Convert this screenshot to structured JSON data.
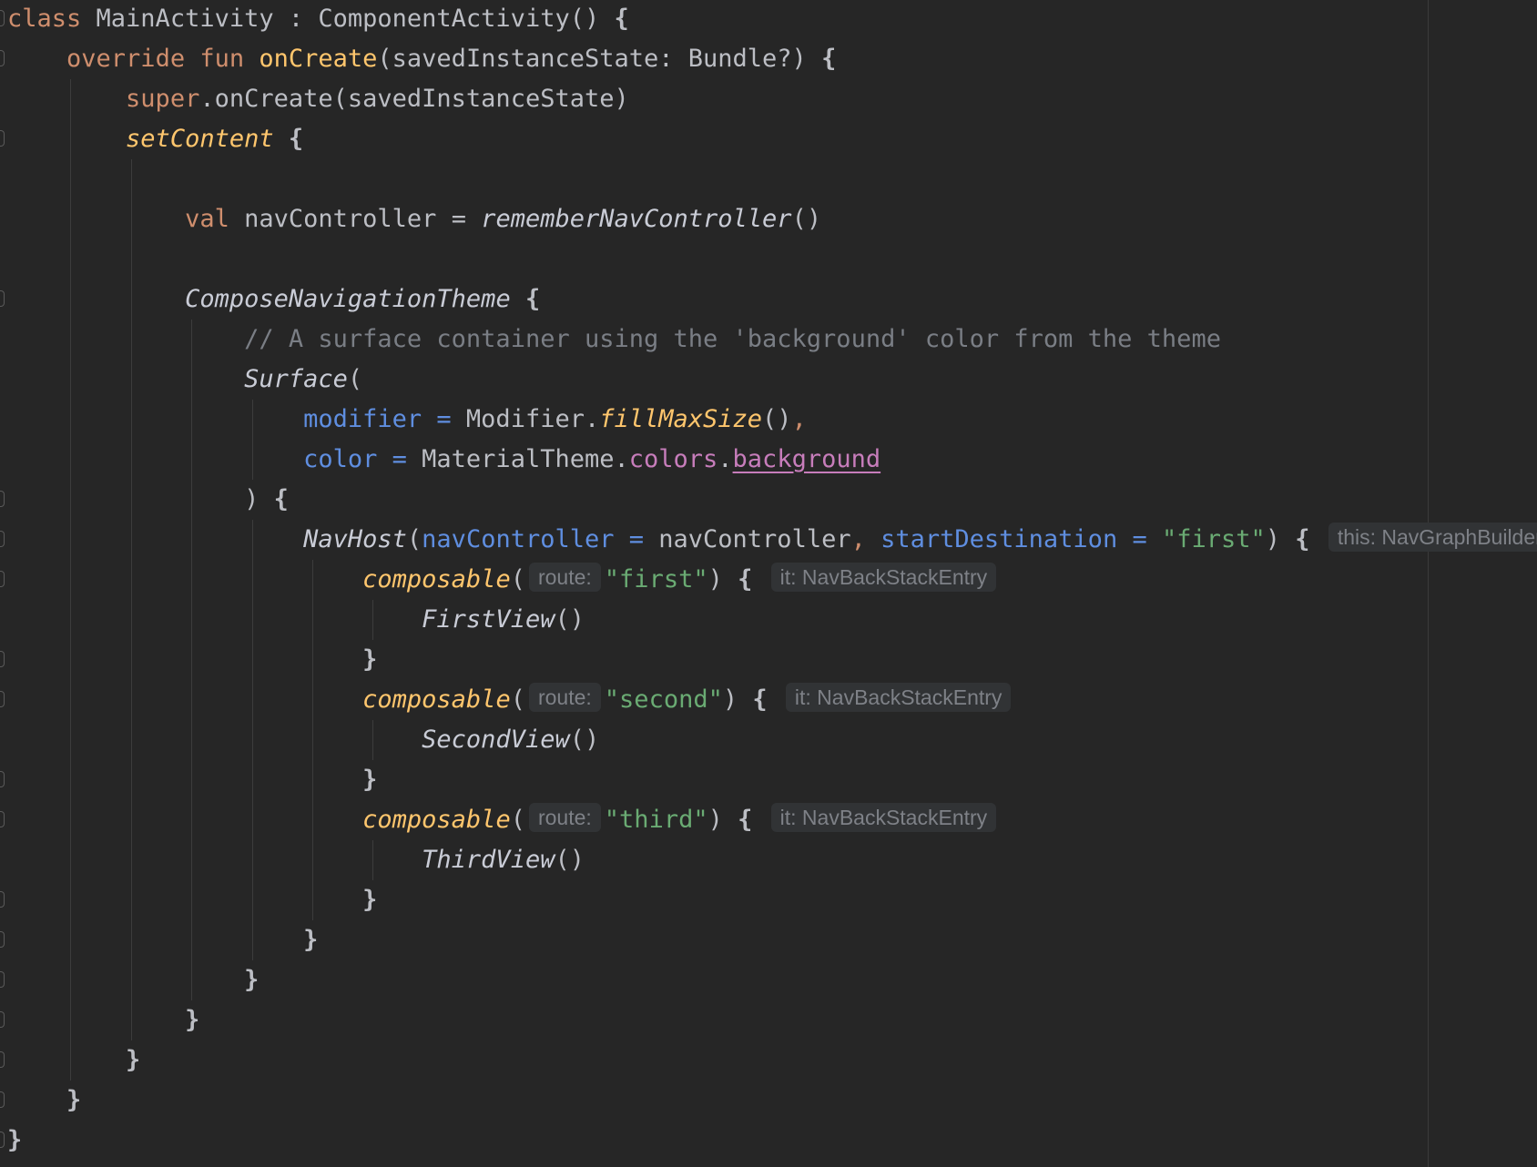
{
  "editor": {
    "theme_colors": {
      "background": "#262626",
      "keyword": "#cf8e6d",
      "function": "#ffc66d",
      "parameter": "#5f8ee0",
      "property": "#c77dbb",
      "string": "#6aab73",
      "comment": "#7a7e85",
      "text": "#bcbec4"
    },
    "lines": [
      [
        {
          "t": "kw",
          "v": "class"
        },
        {
          "t": "plain",
          "v": " MainActivity : ComponentActivity() "
        },
        {
          "t": "brace",
          "v": "{"
        }
      ],
      [
        {
          "t": "plain",
          "v": "    "
        },
        {
          "t": "kw",
          "v": "override fun "
        },
        {
          "t": "fn",
          "v": "onCreate"
        },
        {
          "t": "plain",
          "v": "(savedInstanceState: Bundle?) "
        },
        {
          "t": "brace",
          "v": "{"
        }
      ],
      [
        {
          "t": "plain",
          "v": "        "
        },
        {
          "t": "kw",
          "v": "super"
        },
        {
          "t": "plain",
          "v": ".onCreate(savedInstanceState)"
        }
      ],
      [
        {
          "t": "plain",
          "v": "        "
        },
        {
          "t": "fn-it",
          "v": "setContent"
        },
        {
          "t": "plain",
          "v": " "
        },
        {
          "t": "brace",
          "v": "{"
        }
      ],
      [],
      [
        {
          "t": "plain",
          "v": "            "
        },
        {
          "t": "kw",
          "v": "val"
        },
        {
          "t": "plain",
          "v": " navController = "
        },
        {
          "t": "it",
          "v": "rememberNavController"
        },
        {
          "t": "plain",
          "v": "()"
        }
      ],
      [],
      [
        {
          "t": "plain",
          "v": "            "
        },
        {
          "t": "it",
          "v": "ComposeNavigationTheme"
        },
        {
          "t": "plain",
          "v": " "
        },
        {
          "t": "brace",
          "v": "{"
        }
      ],
      [
        {
          "t": "plain",
          "v": "                "
        },
        {
          "t": "cmt",
          "v": "// A surface container using the 'background' color from the theme"
        }
      ],
      [
        {
          "t": "plain",
          "v": "                "
        },
        {
          "t": "it",
          "v": "Surface"
        },
        {
          "t": "plain",
          "v": "("
        }
      ],
      [
        {
          "t": "plain",
          "v": "                    "
        },
        {
          "t": "param",
          "v": "modifier = "
        },
        {
          "t": "plain",
          "v": "Modifier."
        },
        {
          "t": "fn-it",
          "v": "fillMaxSize"
        },
        {
          "t": "plain",
          "v": "()"
        },
        {
          "t": "kw",
          "v": ","
        }
      ],
      [
        {
          "t": "plain",
          "v": "                    "
        },
        {
          "t": "param",
          "v": "color = "
        },
        {
          "t": "plain",
          "v": "MaterialTheme."
        },
        {
          "t": "prop",
          "v": "colors"
        },
        {
          "t": "plain",
          "v": "."
        },
        {
          "t": "prop-u",
          "v": "background"
        }
      ],
      [
        {
          "t": "plain",
          "v": "                ) "
        },
        {
          "t": "brace",
          "v": "{"
        }
      ],
      [
        {
          "t": "plain",
          "v": "                    "
        },
        {
          "t": "it",
          "v": "NavHost"
        },
        {
          "t": "plain",
          "v": "("
        },
        {
          "t": "param",
          "v": "navController = "
        },
        {
          "t": "plain",
          "v": "navController"
        },
        {
          "t": "kw",
          "v": ", "
        },
        {
          "t": "param",
          "v": "startDestination = "
        },
        {
          "t": "str",
          "v": "\"first\""
        },
        {
          "t": "plain",
          "v": ") "
        },
        {
          "t": "brace",
          "v": "{"
        },
        {
          "t": "plain",
          "v": " "
        },
        {
          "t": "hint",
          "v": "this: NavGraphBuilder"
        }
      ],
      [
        {
          "t": "plain",
          "v": "                        "
        },
        {
          "t": "fn-it",
          "v": "composable"
        },
        {
          "t": "plain",
          "v": "("
        },
        {
          "t": "hint",
          "v": "route:"
        },
        {
          "t": "str",
          "v": "\"first\""
        },
        {
          "t": "plain",
          "v": ") "
        },
        {
          "t": "brace",
          "v": "{"
        },
        {
          "t": "plain",
          "v": " "
        },
        {
          "t": "hint",
          "v": "it: NavBackStackEntry"
        }
      ],
      [
        {
          "t": "plain",
          "v": "                            "
        },
        {
          "t": "it",
          "v": "FirstView"
        },
        {
          "t": "plain",
          "v": "()"
        }
      ],
      [
        {
          "t": "plain",
          "v": "                        "
        },
        {
          "t": "brace",
          "v": "}"
        }
      ],
      [
        {
          "t": "plain",
          "v": "                        "
        },
        {
          "t": "fn-it",
          "v": "composable"
        },
        {
          "t": "plain",
          "v": "("
        },
        {
          "t": "hint",
          "v": "route:"
        },
        {
          "t": "str",
          "v": "\"second\""
        },
        {
          "t": "plain",
          "v": ") "
        },
        {
          "t": "brace",
          "v": "{"
        },
        {
          "t": "plain",
          "v": " "
        },
        {
          "t": "hint",
          "v": "it: NavBackStackEntry"
        }
      ],
      [
        {
          "t": "plain",
          "v": "                            "
        },
        {
          "t": "it",
          "v": "SecondView"
        },
        {
          "t": "plain",
          "v": "()"
        }
      ],
      [
        {
          "t": "plain",
          "v": "                        "
        },
        {
          "t": "brace",
          "v": "}"
        }
      ],
      [
        {
          "t": "plain",
          "v": "                        "
        },
        {
          "t": "fn-it",
          "v": "composable"
        },
        {
          "t": "plain",
          "v": "("
        },
        {
          "t": "hint",
          "v": "route:"
        },
        {
          "t": "str",
          "v": "\"third\""
        },
        {
          "t": "plain",
          "v": ") "
        },
        {
          "t": "brace",
          "v": "{"
        },
        {
          "t": "plain",
          "v": " "
        },
        {
          "t": "hint",
          "v": "it: NavBackStackEntry"
        }
      ],
      [
        {
          "t": "plain",
          "v": "                            "
        },
        {
          "t": "it",
          "v": "ThirdView"
        },
        {
          "t": "plain",
          "v": "()"
        }
      ],
      [
        {
          "t": "plain",
          "v": "                        "
        },
        {
          "t": "brace",
          "v": "}"
        }
      ],
      [
        {
          "t": "plain",
          "v": "                    "
        },
        {
          "t": "brace",
          "v": "}"
        }
      ],
      [
        {
          "t": "plain",
          "v": "                "
        },
        {
          "t": "brace",
          "v": "}"
        }
      ],
      [
        {
          "t": "plain",
          "v": "            "
        },
        {
          "t": "brace",
          "v": "}"
        }
      ],
      [
        {
          "t": "plain",
          "v": "        "
        },
        {
          "t": "brace",
          "v": "}"
        }
      ],
      [
        {
          "t": "plain",
          "v": "    "
        },
        {
          "t": "brace",
          "v": "}"
        }
      ],
      [
        {
          "t": "brace",
          "v": "}"
        }
      ]
    ],
    "fold_marker_lines": [
      0,
      1,
      3,
      7,
      12,
      13,
      14,
      16,
      17,
      19,
      20,
      22,
      23,
      24,
      25,
      26,
      27,
      28
    ]
  }
}
